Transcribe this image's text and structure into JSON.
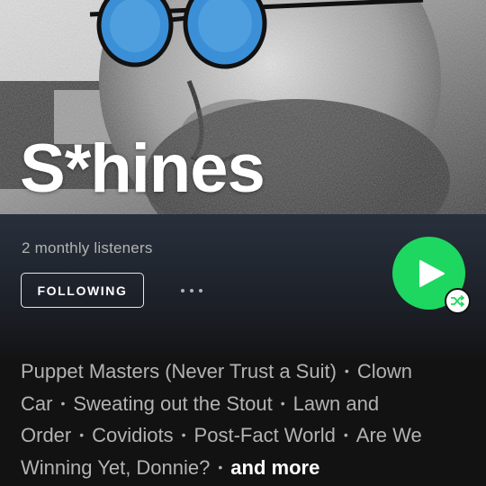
{
  "artist": {
    "name": "S*hines",
    "monthly_listeners": "2 monthly listeners"
  },
  "actions": {
    "follow_label": "FOLLOWING",
    "more_label": "..."
  },
  "popular_tracks": [
    "Puppet Masters (Never Trust a Suit)",
    "Clown Car",
    "Sweating out the Stout",
    "Lawn and Order",
    "Covidiots",
    "Post-Fact World",
    "Are We Winning Yet, Donnie?"
  ],
  "and_more_label": "and more",
  "separator": "•",
  "icons": {
    "play": "play-icon",
    "shuffle": "shuffle-icon",
    "more": "more-options-icon"
  },
  "colors": {
    "accent_green": "#1ed760",
    "background": "#121212",
    "secondary_text": "#b3b3b3",
    "glasses_lens": "#3b8fd6"
  }
}
